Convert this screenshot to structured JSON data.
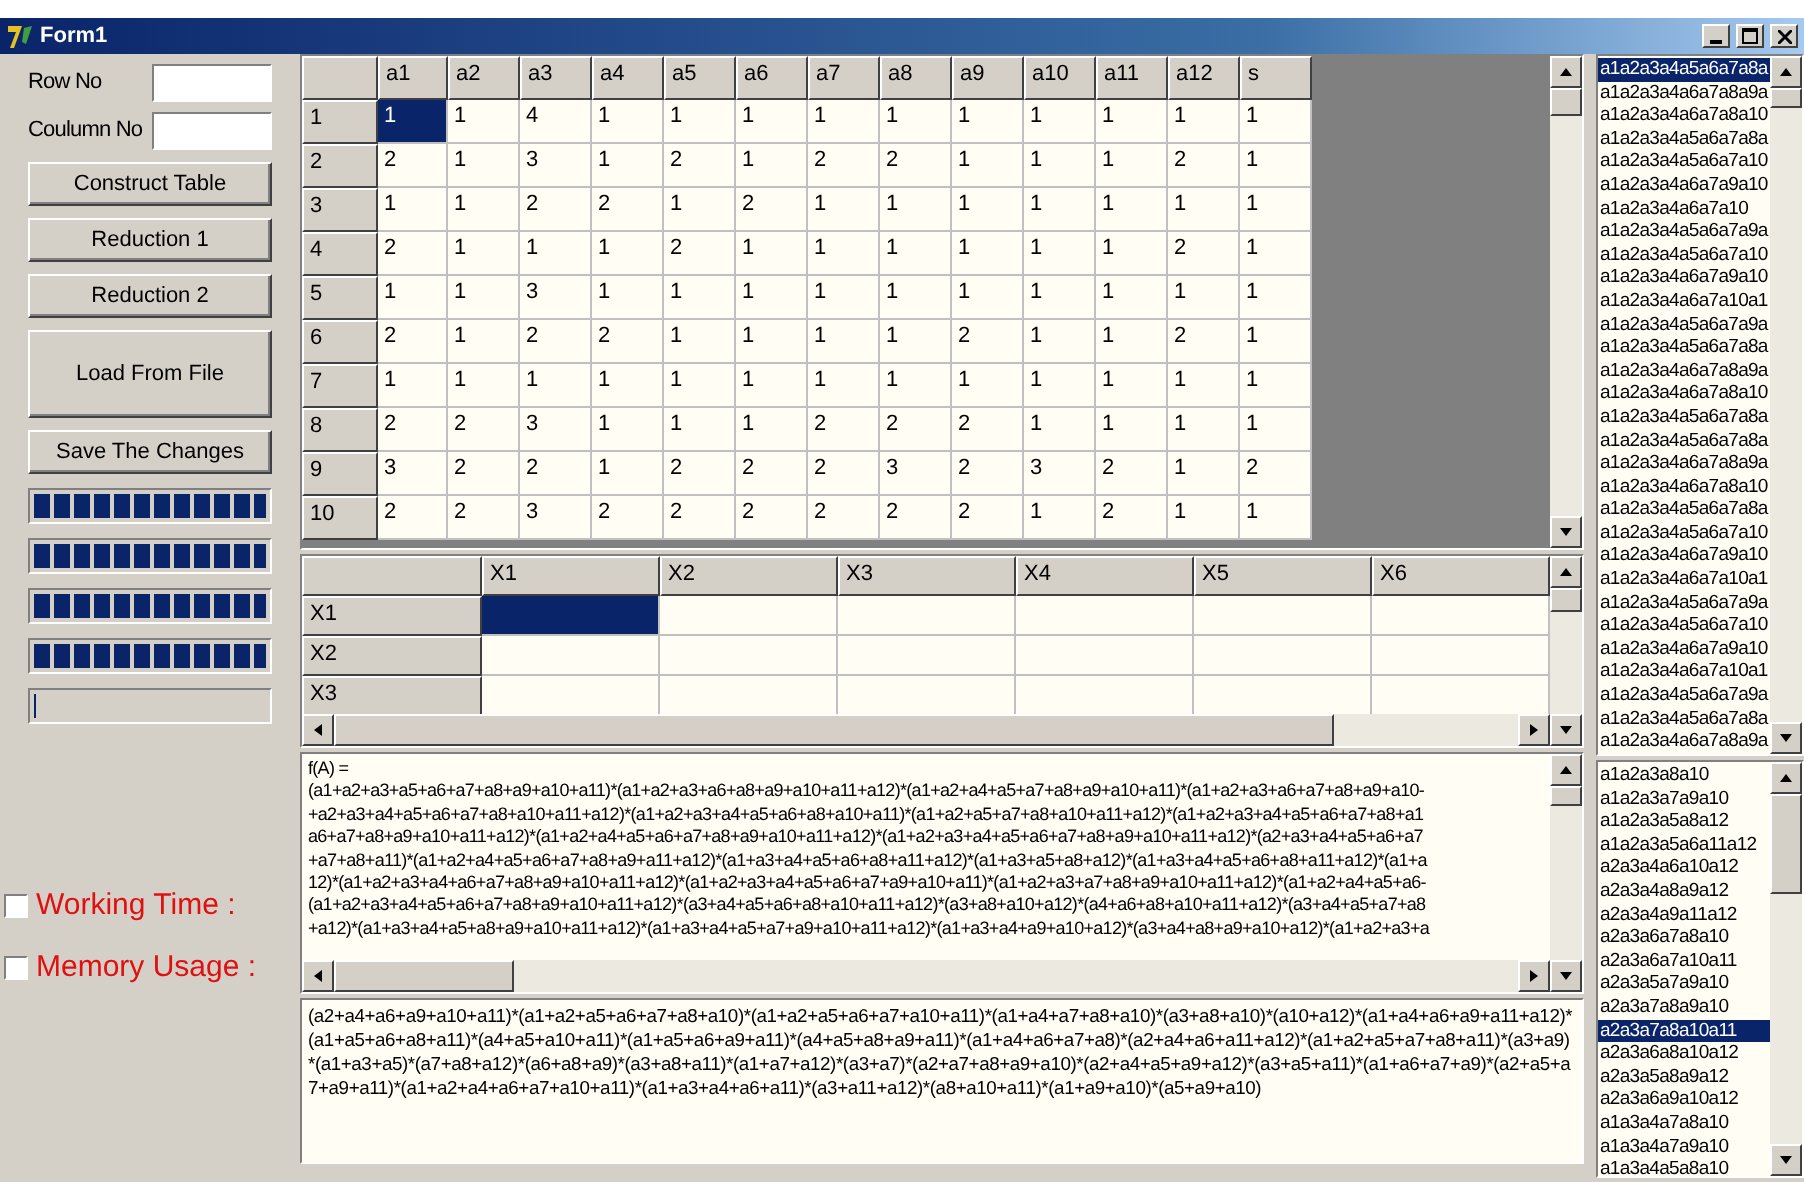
{
  "window": {
    "title": "Form1"
  },
  "fields": [
    {
      "label": "Row No"
    },
    {
      "label": "Coulumn No"
    }
  ],
  "buttons": [
    {
      "label": "Construct Table",
      "kind": "normal"
    },
    {
      "label": "Reduction 1",
      "kind": "normal"
    },
    {
      "label": "Reduction 2",
      "kind": "normal"
    },
    {
      "label": "Load From File",
      "kind": "tall"
    },
    {
      "label": "Save The Changes",
      "kind": "normal"
    }
  ],
  "progress_bars": [
    {
      "level": 1
    },
    {
      "level": 1
    },
    {
      "level": 1
    },
    {
      "level": 1
    },
    {
      "level": 0
    }
  ],
  "checkboxes": [
    {
      "label": "Working Time :",
      "checked": false
    },
    {
      "label": "Memory Usage :",
      "checked": false
    }
  ],
  "table": {
    "columns": [
      "a1",
      "a2",
      "a3",
      "a4",
      "a5",
      "a6",
      "a7",
      "a8",
      "a9",
      "a10",
      "a11",
      "a12",
      "s"
    ],
    "rows": [
      {
        "header": "1",
        "selected": true,
        "cells": [
          "1",
          "1",
          "4",
          "1",
          "1",
          "1",
          "1",
          "1",
          "1",
          "1",
          "1",
          "1",
          "1"
        ]
      },
      {
        "header": "2",
        "selected": false,
        "cells": [
          "2",
          "1",
          "3",
          "1",
          "2",
          "1",
          "2",
          "2",
          "1",
          "1",
          "1",
          "2",
          "1"
        ]
      },
      {
        "header": "3",
        "selected": false,
        "cells": [
          "1",
          "1",
          "2",
          "2",
          "1",
          "2",
          "1",
          "1",
          "1",
          "1",
          "1",
          "1",
          "1"
        ]
      },
      {
        "header": "4",
        "selected": false,
        "cells": [
          "2",
          "1",
          "1",
          "1",
          "2",
          "1",
          "1",
          "1",
          "1",
          "1",
          "1",
          "2",
          "1"
        ]
      },
      {
        "header": "5",
        "selected": false,
        "cells": [
          "1",
          "1",
          "3",
          "1",
          "1",
          "1",
          "1",
          "1",
          "1",
          "1",
          "1",
          "1",
          "1"
        ]
      },
      {
        "header": "6",
        "selected": false,
        "cells": [
          "2",
          "1",
          "2",
          "2",
          "1",
          "1",
          "1",
          "1",
          "2",
          "1",
          "1",
          "2",
          "1"
        ]
      },
      {
        "header": "7",
        "selected": false,
        "cells": [
          "1",
          "1",
          "1",
          "1",
          "1",
          "1",
          "1",
          "1",
          "1",
          "1",
          "1",
          "1",
          "1"
        ]
      },
      {
        "header": "8",
        "selected": false,
        "cells": [
          "2",
          "2",
          "3",
          "1",
          "1",
          "1",
          "2",
          "2",
          "2",
          "1",
          "1",
          "1",
          "1"
        ]
      },
      {
        "header": "9",
        "selected": false,
        "cells": [
          "3",
          "2",
          "2",
          "1",
          "2",
          "2",
          "2",
          "3",
          "2",
          "3",
          "2",
          "1",
          "2"
        ]
      },
      {
        "header": "10",
        "selected": false,
        "cells": [
          "2",
          "2",
          "3",
          "2",
          "2",
          "2",
          "2",
          "2",
          "2",
          "1",
          "2",
          "1",
          "1"
        ]
      }
    ]
  },
  "matrix": {
    "columns": [
      "X1",
      "X2",
      "X3",
      "X4",
      "X5",
      "X6"
    ],
    "rows": [
      {
        "header": "X1",
        "selected": true
      },
      {
        "header": "X2",
        "selected": false
      },
      {
        "header": "X3",
        "selected": false
      }
    ]
  },
  "formula": {
    "lines": [
      "f(A) =",
      "(a1+a2+a3+a5+a6+a7+a8+a9+a10+a11)*(a1+a2+a3+a6+a8+a9+a10+a11+a12)*(a1+a2+a4+a5+a7+a8+a9+a10+a11)*(a1+a2+a3+a6+a7+a8+a9+a10-",
      "+a2+a3+a4+a5+a6+a7+a8+a10+a11+a12)*(a1+a2+a3+a4+a5+a6+a8+a10+a11)*(a1+a2+a5+a7+a8+a10+a11+a12)*(a1+a2+a3+a4+a5+a6+a7+a8+a1",
      "a6+a7+a8+a9+a10+a11+a12)*(a1+a2+a4+a5+a6+a7+a8+a9+a10+a11+a12)*(a1+a2+a3+a4+a5+a6+a7+a8+a9+a10+a11+a12)*(a2+a3+a4+a5+a6+a7",
      "+a7+a8+a11)*(a1+a2+a4+a5+a6+a7+a8+a9+a11+a12)*(a1+a3+a4+a5+a6+a8+a11+a12)*(a1+a3+a5+a8+a12)*(a1+a3+a4+a5+a6+a8+a11+a12)*(a1+a",
      "12)*(a1+a2+a3+a4+a6+a7+a8+a9+a10+a11+a12)*(a1+a2+a3+a4+a5+a6+a7+a9+a10+a11)*(a1+a2+a3+a7+a8+a9+a10+a11+a12)*(a1+a2+a4+a5+a6-",
      "(a1+a2+a3+a4+a5+a6+a7+a8+a9+a10+a11+a12)*(a3+a4+a5+a6+a8+a10+a11+a12)*(a3+a8+a10+a12)*(a4+a6+a8+a10+a11+a12)*(a3+a4+a5+a7+a8",
      "+a12)*(a1+a3+a4+a5+a8+a9+a10+a11+a12)*(a1+a3+a4+a5+a7+a9+a10+a11+a12)*(a1+a3+a4+a9+a10+a12)*(a3+a4+a8+a9+a10+a12)*(a1+a2+a3+a"
    ]
  },
  "result": {
    "text": "(a2+a4+a6+a9+a10+a11)*(a1+a2+a5+a6+a7+a8+a10)*(a1+a2+a5+a6+a7+a10+a11)*(a1+a4+a7+a8+a10)*(a3+a8+a10)*(a10+a12)*(a1+a4+a6+a9+a11+a12)*(a1+a5+a6+a8+a11)*(a4+a5+a10+a11)*(a1+a5+a6+a9+a11)*(a4+a5+a8+a9+a11)*(a1+a4+a6+a7+a8)*(a2+a4+a6+a11+a12)*(a1+a2+a5+a7+a8+a11)*(a3+a9)*(a1+a3+a5)*(a7+a8+a12)*(a6+a8+a9)*(a3+a8+a11)*(a1+a7+a12)*(a3+a7)*(a2+a7+a8+a9+a10)*(a2+a4+a5+a9+a12)*(a3+a5+a11)*(a1+a6+a7+a9)*(a2+a5+a7+a9+a11)*(a1+a2+a4+a6+a7+a10+a11)*(a1+a3+a4+a6+a11)*(a3+a11+a12)*(a8+a10+a11)*(a1+a9+a10)*(a5+a9+a10)"
  },
  "list_top": {
    "items": [
      {
        "text": "a1a2a3a4a5a6a7a8a",
        "selected": true
      },
      {
        "text": "a1a2a3a4a6a7a8a9a",
        "selected": false
      },
      {
        "text": "a1a2a3a4a6a7a8a10",
        "selected": false
      },
      {
        "text": "a1a2a3a4a5a6a7a8a",
        "selected": false
      },
      {
        "text": "a1a2a3a4a5a6a7a10",
        "selected": false
      },
      {
        "text": "a1a2a3a4a6a7a9a10",
        "selected": false
      },
      {
        "text": "a1a2a3a4a6a7a10",
        "selected": false
      },
      {
        "text": "a1a2a3a4a5a6a7a9a",
        "selected": false
      },
      {
        "text": "a1a2a3a4a5a6a7a10",
        "selected": false
      },
      {
        "text": "a1a2a3a4a6a7a9a10",
        "selected": false
      },
      {
        "text": "a1a2a3a4a6a7a10a1",
        "selected": false
      },
      {
        "text": "a1a2a3a4a5a6a7a9a",
        "selected": false
      },
      {
        "text": "a1a2a3a4a5a6a7a8a",
        "selected": false
      },
      {
        "text": "a1a2a3a4a6a7a8a9a",
        "selected": false
      },
      {
        "text": "a1a2a3a4a6a7a8a10",
        "selected": false
      },
      {
        "text": "a1a2a3a4a5a6a7a8a",
        "selected": false
      },
      {
        "text": "a1a2a3a4a5a6a7a8a",
        "selected": false
      },
      {
        "text": "a1a2a3a4a6a7a8a9a",
        "selected": false
      },
      {
        "text": "a1a2a3a4a6a7a8a10",
        "selected": false
      },
      {
        "text": "a1a2a3a4a5a6a7a8a",
        "selected": false
      },
      {
        "text": "a1a2a3a4a5a6a7a10",
        "selected": false
      },
      {
        "text": "a1a2a3a4a6a7a9a10",
        "selected": false
      },
      {
        "text": "a1a2a3a4a6a7a10a1",
        "selected": false
      },
      {
        "text": "a1a2a3a4a5a6a7a9a",
        "selected": false
      },
      {
        "text": "a1a2a3a4a5a6a7a10",
        "selected": false
      },
      {
        "text": "a1a2a3a4a6a7a9a10",
        "selected": false
      },
      {
        "text": "a1a2a3a4a6a7a10a1",
        "selected": false
      },
      {
        "text": "a1a2a3a4a5a6a7a9a",
        "selected": false
      },
      {
        "text": "a1a2a3a4a5a6a7a8a",
        "selected": false
      },
      {
        "text": "a1a2a3a4a6a7a8a9a",
        "selected": false
      }
    ]
  },
  "list_bottom": {
    "items": [
      {
        "text": "a1a2a3a8a10",
        "selected": false
      },
      {
        "text": "a1a2a3a7a9a10",
        "selected": false
      },
      {
        "text": "a1a2a3a5a8a12",
        "selected": false
      },
      {
        "text": "a1a2a3a5a6a11a12",
        "selected": false
      },
      {
        "text": "a2a3a4a6a10a12",
        "selected": false
      },
      {
        "text": "a2a3a4a8a9a12",
        "selected": false
      },
      {
        "text": "a2a3a4a9a11a12",
        "selected": false
      },
      {
        "text": "a2a3a6a7a8a10",
        "selected": false
      },
      {
        "text": "a2a3a6a7a10a11",
        "selected": false
      },
      {
        "text": "a2a3a5a7a9a10",
        "selected": false
      },
      {
        "text": "a2a3a7a8a9a10",
        "selected": false
      },
      {
        "text": "a2a3a7a8a10a11",
        "selected": true
      },
      {
        "text": "a2a3a6a8a10a12",
        "selected": false
      },
      {
        "text": "a2a3a5a8a9a12",
        "selected": false
      },
      {
        "text": "a2a3a6a9a10a12",
        "selected": false
      },
      {
        "text": "a1a3a4a7a8a10",
        "selected": false
      },
      {
        "text": "a1a3a4a7a9a10",
        "selected": false
      },
      {
        "text": "a1a3a4a5a8a10",
        "selected": false
      }
    ]
  }
}
